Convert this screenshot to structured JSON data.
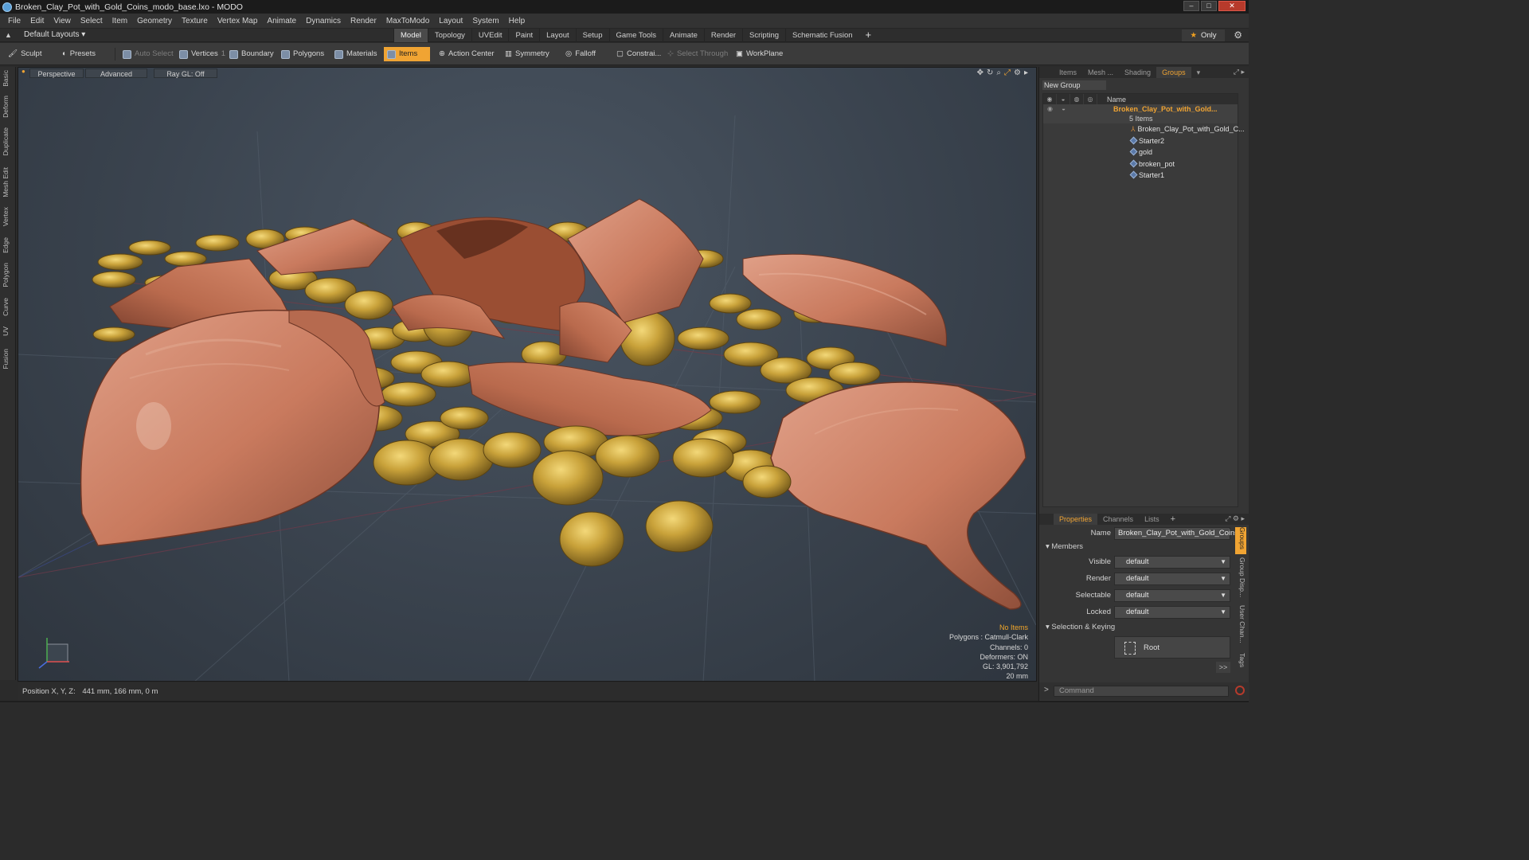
{
  "window": {
    "title": "Broken_Clay_Pot_with_Gold_Coins_modo_base.lxo - MODO",
    "buttons": [
      "–",
      "□",
      "✕"
    ]
  },
  "menubar": [
    "File",
    "Edit",
    "View",
    "Select",
    "Item",
    "Geometry",
    "Texture",
    "Vertex Map",
    "Animate",
    "Dynamics",
    "Render",
    "MaxToModo",
    "Layout",
    "System",
    "Help"
  ],
  "layoutbar": {
    "layout_select": "Default Layouts ▾",
    "tabs": [
      "Model",
      "Topology",
      "UVEdit",
      "Paint",
      "Layout",
      "Setup",
      "Game Tools",
      "Animate",
      "Render",
      "Scripting",
      "Schematic Fusion"
    ],
    "active_tab": "Model",
    "add_tab": "+",
    "only_label": "Only"
  },
  "toolbar": {
    "sculpt": "Sculpt",
    "presets": "Presets",
    "auto_select": "Auto Select",
    "vertices": "Vertices",
    "vertices_count": "1",
    "boundary": "Boundary",
    "polygons": "Polygons",
    "materials": "Materials",
    "items": "Items",
    "action_center": "Action Center",
    "symmetry": "Symmetry",
    "falloff": "Falloff",
    "constraints": "Constrai...",
    "select_through": "Select Through",
    "workplane": "WorkPlane"
  },
  "left_tabs": [
    "Basic",
    "Deform",
    "Duplicate",
    "Mesh Edit",
    "Vertex",
    "Edge",
    "Polygon",
    "Curve",
    "UV",
    "Fusion"
  ],
  "viewport": {
    "view_mode": "Perspective",
    "shading": "Advanced",
    "raygl": "Ray GL: Off",
    "stats": {
      "selection": "No Items",
      "polygons": "Polygons : Catmull-Clark",
      "channels": "Channels: 0",
      "deformers": "Deformers: ON",
      "gl": "GL: 3,901,792",
      "scale": "20 mm"
    },
    "colors": {
      "clay": "#c97a5e",
      "gold": "#c9a23a",
      "background": "#3a434e"
    }
  },
  "statusbar": {
    "position_label": "Position X, Y, Z:",
    "position_value": "441 mm, 166 mm, 0 m"
  },
  "groups_panel": {
    "tabs": [
      "Items",
      "Mesh ...",
      "Shading",
      "Groups"
    ],
    "active_tab": "Groups",
    "new_group": "New Group",
    "name_header": "Name",
    "group_name": "Broken_Clay_Pot_with_Gold...",
    "group_count": "5 Items",
    "items": [
      "Broken_Clay_Pot_with_Gold_C...",
      "Starter2",
      "gold",
      "broken_pot",
      "Starter1"
    ]
  },
  "properties_panel": {
    "tabs": [
      "Properties",
      "Channels",
      "Lists"
    ],
    "active_tab": "Properties",
    "add_tab": "+",
    "name_label": "Name",
    "name_value": "Broken_Clay_Pot_with_Gold_Coins",
    "members_header": "Members",
    "fields": [
      {
        "label": "Visible",
        "value": "default"
      },
      {
        "label": "Render",
        "value": "default"
      },
      {
        "label": "Selectable",
        "value": "default"
      },
      {
        "label": "Locked",
        "value": "default"
      }
    ],
    "selection_keying": "Selection & Keying",
    "root_label": "Root",
    "more": ">>",
    "side_tabs": [
      "Groups",
      "Group Disp...",
      "User Chan...",
      "Tags"
    ]
  },
  "command": {
    "placeholder": "Command",
    "prompt": ">"
  }
}
